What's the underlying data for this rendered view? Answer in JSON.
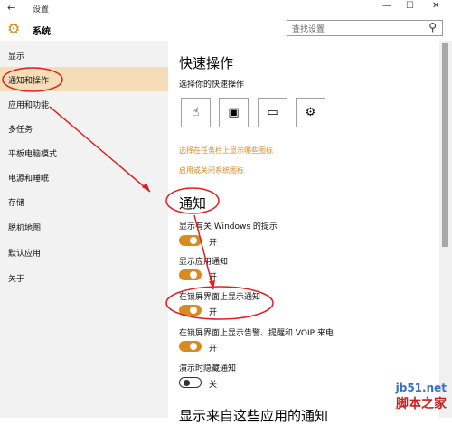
{
  "window": {
    "back_glyph": "←",
    "title": "设置",
    "minimize": "—",
    "maximize": "☐",
    "close": "✕"
  },
  "header": {
    "app_title": "系统",
    "search_placeholder": "查找设置"
  },
  "sidebar": {
    "items": [
      {
        "label": "显示",
        "active": false
      },
      {
        "label": "通知和操作",
        "active": true
      },
      {
        "label": "应用和功能",
        "active": false
      },
      {
        "label": "多任务",
        "active": false
      },
      {
        "label": "平板电脑模式",
        "active": false
      },
      {
        "label": "电源和睡眠",
        "active": false
      },
      {
        "label": "存储",
        "active": false
      },
      {
        "label": "脱机地图",
        "active": false
      },
      {
        "label": "默认应用",
        "active": false
      },
      {
        "label": "关于",
        "active": false
      }
    ]
  },
  "quick_actions": {
    "heading": "快速操作",
    "subheading": "选择你的快速操作",
    "buttons": [
      {
        "icon": "tablet-mode-icon",
        "glyph": "☝"
      },
      {
        "icon": "connect-display-icon",
        "glyph": "▣"
      },
      {
        "icon": "note-icon",
        "glyph": "▭"
      },
      {
        "icon": "settings-gear-icon",
        "glyph": "⚙"
      }
    ],
    "link_taskbar": "选择在任务栏上显示哪些图标",
    "link_system": "启用或关闭系统图标"
  },
  "notifications": {
    "heading": "通知",
    "settings": [
      {
        "label": "显示有关 Windows 的提示",
        "state": "开",
        "on": true
      },
      {
        "label": "显示应用通知",
        "state": "开",
        "on": true
      },
      {
        "label": "在锁屏界面上显示通知",
        "state": "开",
        "on": true
      },
      {
        "label": "在锁屏界面上显示告警、提醒和 VOIP 来电",
        "state": "开",
        "on": true
      },
      {
        "label": "演示时隐藏通知",
        "state": "关",
        "on": false
      }
    ],
    "partial_heading": "显示来自这些应用的通知"
  },
  "watermark": {
    "line1": "jb51.net",
    "line2": "脚本之家"
  },
  "colors": {
    "accent": "#d98b1f",
    "active_bg": "#f4ddb7",
    "sidebar_bg": "#f2f2f2",
    "annotation_red": "#e02020"
  }
}
